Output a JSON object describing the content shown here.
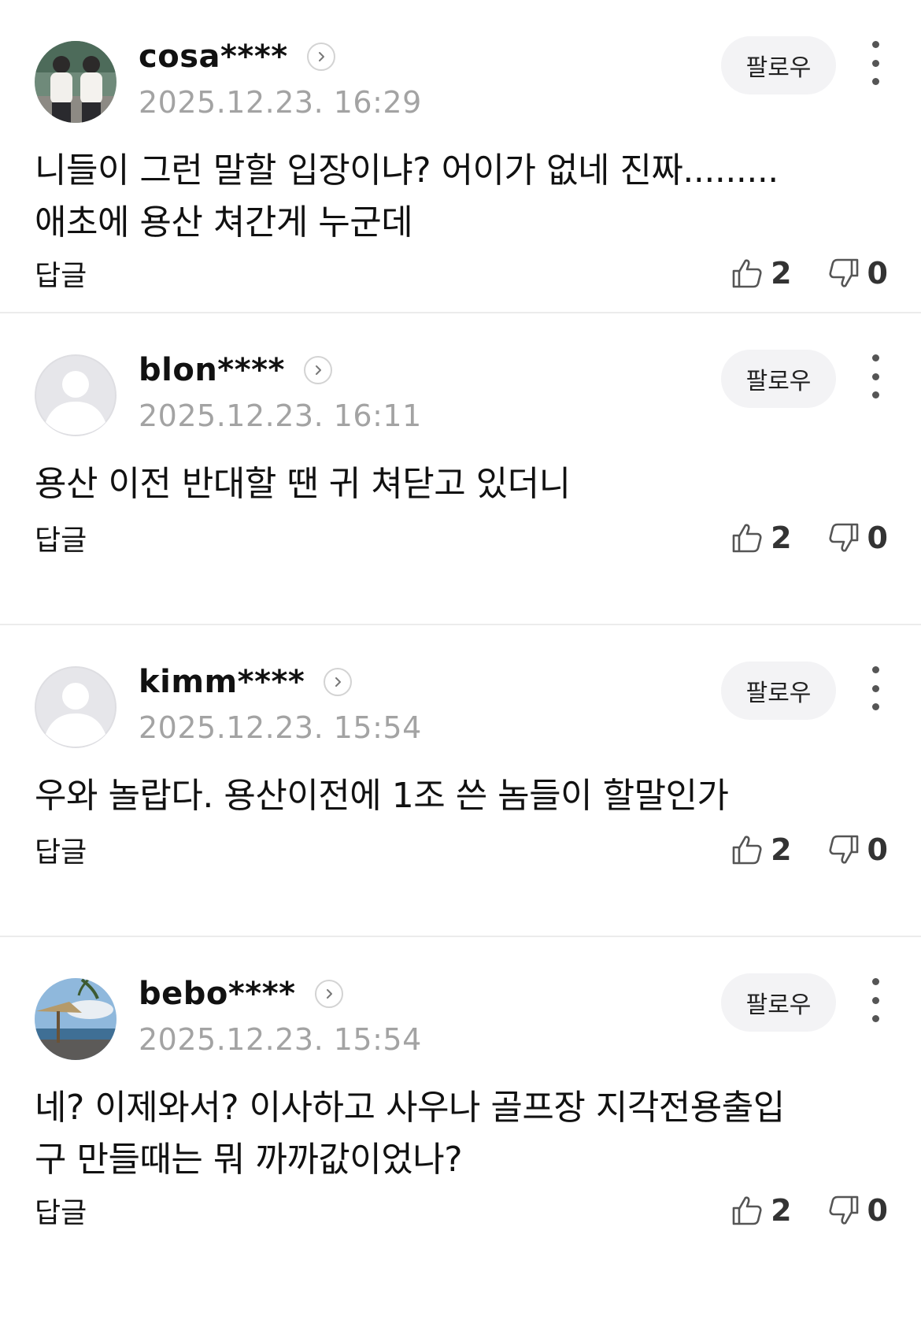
{
  "follow_label": "팔로우",
  "reply_label": "답글",
  "comments": [
    {
      "username": "cosa****",
      "time": "2025.12.23. 16:29",
      "avatar": "photo-two-men",
      "text_lines": [
        "니들이 그런 말할 입장이냐? 어이가 없네 진짜.........",
        "애초에 용산 쳐간게 누군데"
      ],
      "likes": "2",
      "dislikes": "0"
    },
    {
      "username": "blon****",
      "time": "2025.12.23. 16:11",
      "avatar": "default-person",
      "text_lines": [
        "용산 이전 반대할 땐 귀 쳐닫고 있더니"
      ],
      "likes": "2",
      "dislikes": "0"
    },
    {
      "username": "kimm****",
      "time": "2025.12.23. 15:54",
      "avatar": "default-person",
      "text_lines": [
        "우와 놀랍다. 용산이전에 1조 쓴 놈들이 할말인가"
      ],
      "likes": "2",
      "dislikes": "0"
    },
    {
      "username": "bebo****",
      "time": "2025.12.23. 15:54",
      "avatar": "photo-beach",
      "text_lines": [
        "네? 이제와서? 이사하고 사우나 골프장 지각전용출입",
        "구 만들때는 뭐 까까값이었나?"
      ],
      "likes": "2",
      "dislikes": "0"
    }
  ]
}
